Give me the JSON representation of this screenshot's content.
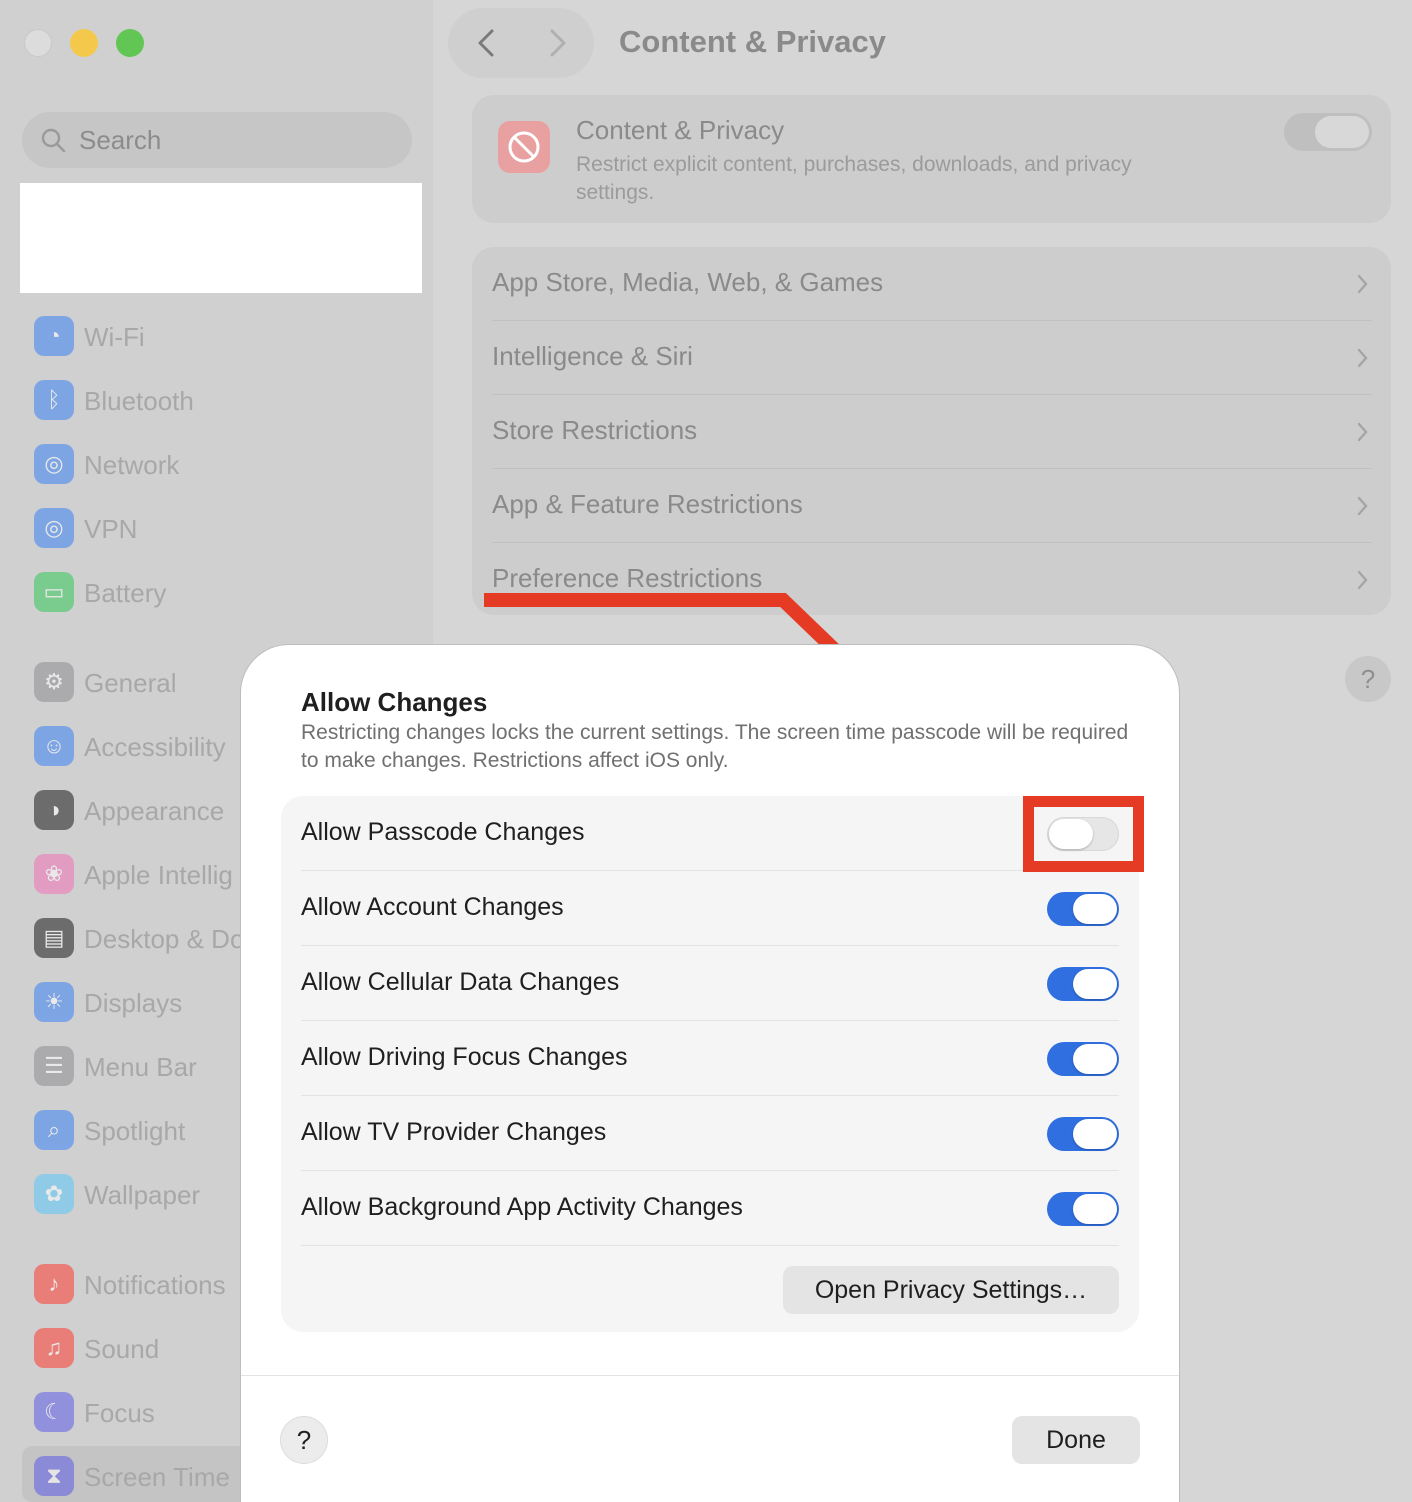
{
  "window": {
    "title": "Content & Privacy"
  },
  "sidebar": {
    "search_placeholder": "Search",
    "items": [
      {
        "label": "Wi-Fi",
        "icon": "wifi-icon",
        "color": "#3b82f6"
      },
      {
        "label": "Bluetooth",
        "icon": "bluetooth-icon",
        "color": "#3b82f6"
      },
      {
        "label": "Network",
        "icon": "globe-icon",
        "color": "#3b82f6"
      },
      {
        "label": "VPN",
        "icon": "vpn-globe-icon",
        "color": "#3b82f6"
      },
      {
        "label": "Battery",
        "icon": "battery-icon",
        "color": "#34c759"
      },
      {
        "label": "General",
        "icon": "gear-icon",
        "color": "#8e8e93"
      },
      {
        "label": "Accessibility",
        "icon": "accessibility-icon",
        "color": "#3b82f6"
      },
      {
        "label": "Appearance",
        "icon": "appearance-icon",
        "color": "#1c1c1e"
      },
      {
        "label": "Apple Intellig",
        "icon": "apple-intelligence-icon",
        "color": "#f472b6"
      },
      {
        "label": "Desktop & Do",
        "icon": "desktop-icon",
        "color": "#1c1c1e"
      },
      {
        "label": "Displays",
        "icon": "sun-icon",
        "color": "#3b82f6"
      },
      {
        "label": "Menu Bar",
        "icon": "menu-bar-icon",
        "color": "#8e8e93"
      },
      {
        "label": "Spotlight",
        "icon": "spotlight-search-icon",
        "color": "#3b82f6"
      },
      {
        "label": "Wallpaper",
        "icon": "flower-icon",
        "color": "#5ac8fa"
      },
      {
        "label": "Notifications",
        "icon": "bell-icon",
        "color": "#ff3b30"
      },
      {
        "label": "Sound",
        "icon": "speaker-icon",
        "color": "#ff3b30"
      },
      {
        "label": "Focus",
        "icon": "moon-icon",
        "color": "#5e5ce6"
      },
      {
        "label": "Screen Time",
        "icon": "hourglass-icon",
        "color": "#5e5ce6"
      }
    ]
  },
  "content_privacy": {
    "title": "Content & Privacy",
    "description": "Restrict explicit content, purchases, downloads, and privacy settings.",
    "enabled": true
  },
  "restrictions": [
    {
      "label": "App Store, Media, Web, & Games"
    },
    {
      "label": "Intelligence & Siri"
    },
    {
      "label": "Store Restrictions"
    },
    {
      "label": "App & Feature Restrictions"
    },
    {
      "label": "Preference Restrictions"
    }
  ],
  "main_help_label": "?",
  "modal": {
    "title": "Allow Changes",
    "description": "Restricting changes locks the current settings. The screen time passcode will be required to make changes. Restrictions affect iOS only.",
    "options": [
      {
        "label": "Allow Passcode Changes",
        "enabled": false
      },
      {
        "label": "Allow Account Changes",
        "enabled": true
      },
      {
        "label": "Allow Cellular Data Changes",
        "enabled": true
      },
      {
        "label": "Allow Driving Focus Changes",
        "enabled": true
      },
      {
        "label": "Allow TV Provider Changes",
        "enabled": true
      },
      {
        "label": "Allow Background App Activity Changes",
        "enabled": true
      }
    ],
    "open_privacy_label": "Open Privacy Settings…",
    "help_label": "?",
    "done_label": "Done"
  },
  "colors": {
    "accent": "#2f6fe0",
    "annotation_red": "#e53a24",
    "tl_min": "#f4c94b",
    "tl_max": "#62c655"
  }
}
